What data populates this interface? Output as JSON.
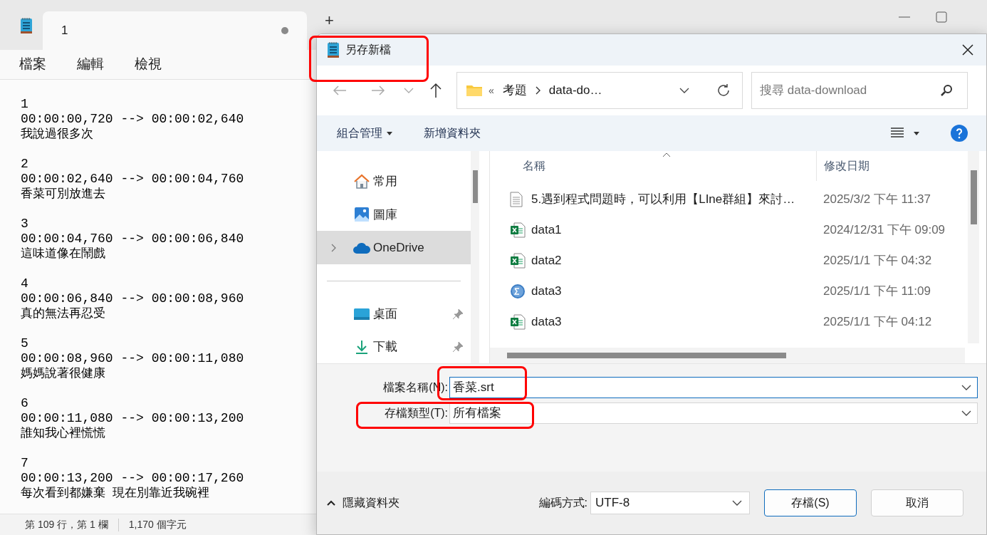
{
  "notepad": {
    "tabs": [
      {
        "label": "1",
        "unsaved": true,
        "selected": true
      }
    ],
    "new_tab": "+",
    "menu": [
      "檔案",
      "編輯",
      "檢視"
    ],
    "blocks": [
      {
        "index": "1",
        "time": "00:00:00,720 --> 00:00:02,640",
        "text": "我說過很多次"
      },
      {
        "index": "2",
        "time": "00:00:02,640 --> 00:00:04,760",
        "text": "香菜可別放進去"
      },
      {
        "index": "3",
        "time": "00:00:04,760 --> 00:00:06,840",
        "text": "這味道像在鬧戲"
      },
      {
        "index": "4",
        "time": "00:00:06,840 --> 00:00:08,960",
        "text": "真的無法再忍受"
      },
      {
        "index": "5",
        "time": "00:00:08,960 --> 00:00:11,080",
        "text": "媽媽說著很健康"
      },
      {
        "index": "6",
        "time": "00:00:11,080 --> 00:00:13,200",
        "text": "誰知我心裡慌慌"
      },
      {
        "index": "7",
        "time": "00:00:13,200 --> 00:00:17,260",
        "text": "每次看到都嫌棄 現在別靠近我碗裡"
      }
    ],
    "status": [
      "第 109 行，第 1 欄",
      "1,170 個字元"
    ]
  },
  "dialog": {
    "title": "另存新檔",
    "breadcrumb": {
      "overflow": "«",
      "items": [
        "考題",
        "data-do…"
      ]
    },
    "search": {
      "placeholder": "搜尋 data-download"
    },
    "toolbar": {
      "organize": "組合管理",
      "new_folder": "新增資料夾"
    },
    "nav": [
      {
        "kind": "home",
        "label": "常用",
        "selected": false,
        "pinned": false
      },
      {
        "kind": "gallery",
        "label": "圖庫",
        "selected": false,
        "pinned": false
      },
      {
        "kind": "cloud",
        "label": "OneDrive",
        "selected": true,
        "pinned": false
      },
      {
        "kind": "desktop",
        "label": "桌面",
        "selected": false,
        "pinned": true
      },
      {
        "kind": "download",
        "label": "下載",
        "selected": false,
        "pinned": true
      }
    ],
    "columns": [
      "名稱",
      "修改日期"
    ],
    "files": [
      {
        "kind": "text",
        "name": "5.遇到程式問題時，可以利用【LIne群組】來討…",
        "date": "2025/3/2 下午 11:37"
      },
      {
        "kind": "excel",
        "name": "data1",
        "date": "2024/12/31 下午 09:09"
      },
      {
        "kind": "excel",
        "name": "data2",
        "date": "2025/1/1 下午 04:32"
      },
      {
        "kind": "stats",
        "name": "data3",
        "date": "2025/1/1 下午 11:09"
      },
      {
        "kind": "excel",
        "name": "data3",
        "date": "2025/1/1 下午 04:12"
      }
    ],
    "filename_label": "檔案名稱(N):",
    "filename": "香菜.srt",
    "type_label": "存檔類型(T):",
    "type": "所有檔案",
    "hide_folders": "隱藏資料夾",
    "encoding_label": "編碼方式:",
    "encoding": "UTF-8",
    "buttons": [
      {
        "label": "存檔(S)",
        "primary": true
      },
      {
        "label": "取消",
        "primary": false
      }
    ]
  }
}
